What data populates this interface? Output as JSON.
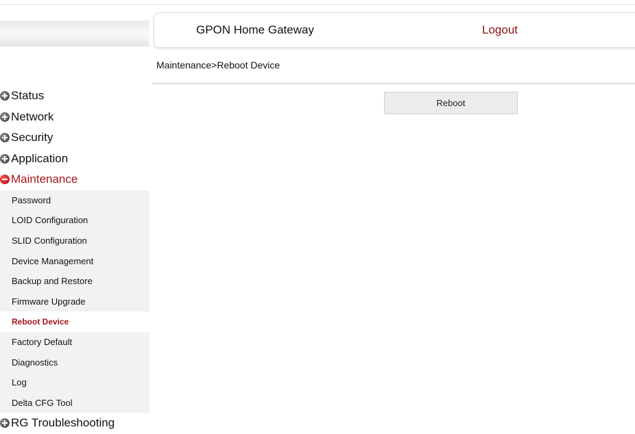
{
  "header": {
    "title": "GPON Home Gateway",
    "logout_label": "Logout"
  },
  "breadcrumb": "Maintenance>Reboot Device",
  "main": {
    "reboot_button_label": "Reboot"
  },
  "sidebar": {
    "items": [
      {
        "label": "Status"
      },
      {
        "label": "Network"
      },
      {
        "label": "Security"
      },
      {
        "label": "Application"
      },
      {
        "label": "Maintenance",
        "expanded": true
      },
      {
        "label": "RG Troubleshooting"
      }
    ],
    "maintenance_subitems": [
      {
        "label": "Password"
      },
      {
        "label": "LOID Configuration"
      },
      {
        "label": "SLID Configuration"
      },
      {
        "label": "Device Management"
      },
      {
        "label": "Backup and Restore"
      },
      {
        "label": "Firmware Upgrade"
      },
      {
        "label": "Reboot Device",
        "active": true
      },
      {
        "label": "Factory Default"
      },
      {
        "label": "Diagnostics"
      },
      {
        "label": "Log"
      },
      {
        "label": "Delta CFG Tool"
      }
    ]
  },
  "colors": {
    "accent": "#a5141a",
    "logout": "#8b0e0e",
    "submenu_bg": "#f2f2f2"
  }
}
